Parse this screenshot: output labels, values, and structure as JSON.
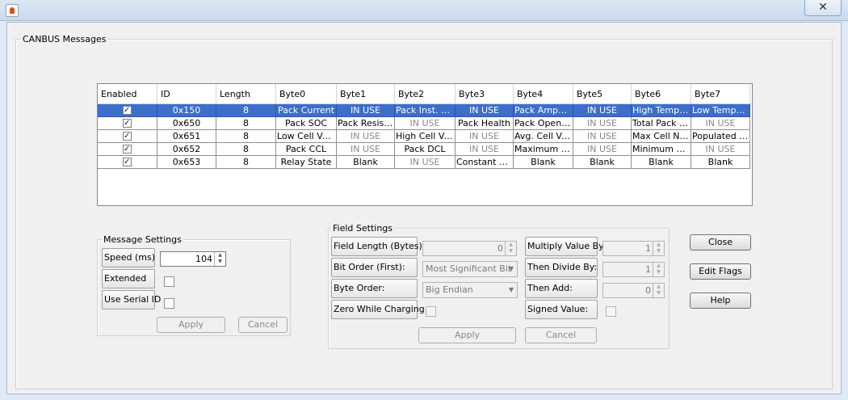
{
  "window": {
    "close_glyph": "✕",
    "app_icon": "java-icon"
  },
  "canbus": {
    "title": "CANBUS Messages",
    "columns": [
      "Enabled",
      "ID",
      "Length",
      "Byte0",
      "Byte1",
      "Byte2",
      "Byte3",
      "Byte4",
      "Byte5",
      "Byte6",
      "Byte7"
    ],
    "rows": [
      {
        "enabled": true,
        "selected": true,
        "cells": [
          "0x150",
          "8",
          "Pack Current",
          "IN USE",
          "Pack Inst. Voltage",
          "IN USE",
          "Pack Amphours",
          "IN USE",
          "High Temperature",
          "Low Temperature"
        ]
      },
      {
        "enabled": true,
        "selected": false,
        "cells": [
          "0x650",
          "8",
          "Pack SOC",
          "Pack Resistance",
          "IN USE",
          "Pack Health",
          "Pack Open Voltage",
          "IN USE",
          "Total Pack Cycles",
          "IN USE"
        ]
      },
      {
        "enabled": true,
        "selected": false,
        "cells": [
          "0x651",
          "8",
          "Low Cell Voltage",
          "IN USE",
          "High Cell Voltage",
          "IN USE",
          "Avg. Cell Voltage",
          "IN USE",
          "Max Cell Number",
          "Populated Cells"
        ]
      },
      {
        "enabled": true,
        "selected": false,
        "cells": [
          "0x652",
          "8",
          "Pack CCL",
          "IN USE",
          "Pack DCL",
          "IN USE",
          "Maximum Cell",
          "IN USE",
          "Minimum Cell",
          "IN USE"
        ]
      },
      {
        "enabled": true,
        "selected": false,
        "cells": [
          "0x653",
          "8",
          "Relay State",
          "Blank",
          "IN USE",
          "Constant Value",
          "Blank",
          "Blank",
          "Blank",
          "Blank"
        ]
      }
    ]
  },
  "message_settings": {
    "title": "Message Settings",
    "speed_label": "Speed (ms)",
    "speed_value": "104",
    "extended_label": "Extended",
    "extended_checked": false,
    "serial_label": "Use Serial ID",
    "serial_checked": false,
    "apply_label": "Apply",
    "cancel_label": "Cancel"
  },
  "field_settings": {
    "title": "Field Settings",
    "field_length_label": "Field Length (Bytes):",
    "field_length_value": "0",
    "bit_order_label": "Bit Order (First):",
    "bit_order_value": "Most Significant Bit",
    "byte_order_label": "Byte Order:",
    "byte_order_value": "Big Endian",
    "zero_label": "Zero While Charging:",
    "multiply_label": "Multiply Value By:",
    "multiply_value": "1",
    "divide_label": "Then Divide By:",
    "divide_value": "1",
    "add_label": "Then Add:",
    "add_value": "0",
    "signed_label": "Signed Value:",
    "apply_label": "Apply",
    "cancel_label": "Cancel"
  },
  "actions": {
    "close_label": "Close",
    "edit_flags_label": "Edit Flags",
    "help_label": "Help"
  }
}
